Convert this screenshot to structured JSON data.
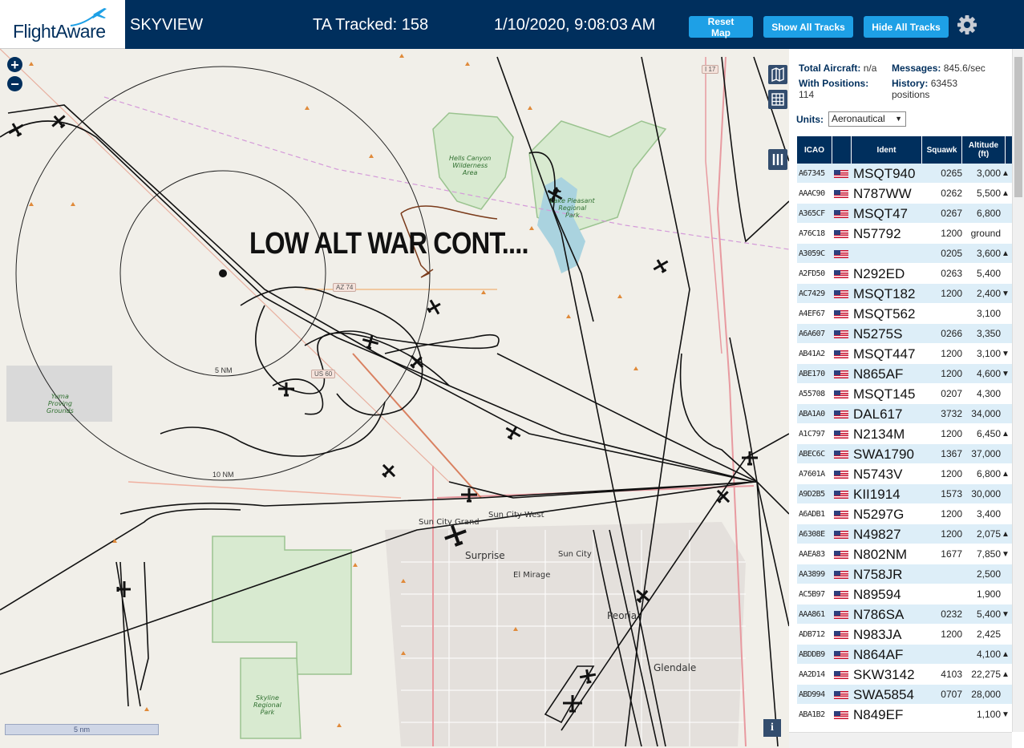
{
  "header": {
    "brand": "FlightAware",
    "app_name": "SKYVIEW",
    "tracked": "TA Tracked: 158",
    "datetime": "1/10/2020, 9:08:03 AM",
    "reset_label": "Reset Map",
    "show_label": "Show All Tracks",
    "hide_label": "Hide All Tracks",
    "accent_color": "#1ea0e6",
    "bar_color": "#002f5d"
  },
  "map": {
    "overlay_text": "LOW ALT WAR CONT....",
    "scale_label": "5 nm",
    "range_rings": [
      "5 NM",
      "10 NM"
    ],
    "places": {
      "hells_canyon": [
        "Hells Canyon",
        "Wilderness",
        "Area"
      ],
      "lake_pleasant": [
        "Lake Pleasant",
        "Regional",
        "Park"
      ],
      "yuma_proving": [
        "Yuma",
        "Proving",
        "Grounds"
      ],
      "skyline": [
        "Skyline",
        "Regional",
        "Park"
      ],
      "surprise": "Surprise",
      "sun_city": "Sun City",
      "sun_city_west": "Sun City West",
      "sun_city_grand": "Sun City Grand",
      "el_mirage": "El Mirage",
      "peoria": "Peoria",
      "glendale": "Glendale"
    },
    "road_labels": [
      "AZ 74",
      "US 60",
      "I 17"
    ]
  },
  "sidebar": {
    "total_label": "Total Aircraft:",
    "total_value": "n/a",
    "messages_label": "Messages:",
    "messages_value": "845.6/sec",
    "positions_label": "With Positions:",
    "positions_value": "114",
    "history_label": "History:",
    "history_value": "63453",
    "history_unit": "positions",
    "units_label": "Units:",
    "units_value": "Aeronautical",
    "columns": {
      "icao": "ICAO",
      "ident": "Ident",
      "squawk": "Squawk",
      "altitude": "Altitude (ft)"
    },
    "rows": [
      {
        "icao": "A67345",
        "ident": "MSQT940",
        "squawk": "0265",
        "alt": "3,000",
        "trend": "▲"
      },
      {
        "icao": "AAAC90",
        "ident": "N787WW",
        "squawk": "0262",
        "alt": "5,500",
        "trend": "▲"
      },
      {
        "icao": "A365CF",
        "ident": "MSQT47",
        "squawk": "0267",
        "alt": "6,800",
        "trend": ""
      },
      {
        "icao": "A76C18",
        "ident": "N57792",
        "squawk": "1200",
        "alt": "ground",
        "trend": ""
      },
      {
        "icao": "A3059C",
        "ident": "",
        "squawk": "0205",
        "alt": "3,600",
        "trend": "▲"
      },
      {
        "icao": "A2FD50",
        "ident": "N292ED",
        "squawk": "0263",
        "alt": "5,400",
        "trend": ""
      },
      {
        "icao": "AC7429",
        "ident": "MSQT182",
        "squawk": "1200",
        "alt": "2,400",
        "trend": "▼"
      },
      {
        "icao": "A4EF67",
        "ident": "MSQT562",
        "squawk": "",
        "alt": "3,100",
        "trend": ""
      },
      {
        "icao": "A6A607",
        "ident": "N5275S",
        "squawk": "0266",
        "alt": "3,350",
        "trend": ""
      },
      {
        "icao": "AB41A2",
        "ident": "MSQT447",
        "squawk": "1200",
        "alt": "3,100",
        "trend": "▼"
      },
      {
        "icao": "ABE170",
        "ident": "N865AF",
        "squawk": "1200",
        "alt": "4,600",
        "trend": "▼"
      },
      {
        "icao": "A55708",
        "ident": "MSQT145",
        "squawk": "0207",
        "alt": "4,300",
        "trend": ""
      },
      {
        "icao": "ABA1A0",
        "ident": "DAL617",
        "squawk": "3732",
        "alt": "34,000",
        "trend": ""
      },
      {
        "icao": "A1C797",
        "ident": "N2134M",
        "squawk": "1200",
        "alt": "6,450",
        "trend": "▲"
      },
      {
        "icao": "ABEC6C",
        "ident": "SWA1790",
        "squawk": "1367",
        "alt": "37,000",
        "trend": ""
      },
      {
        "icao": "A7601A",
        "ident": "N5743V",
        "squawk": "1200",
        "alt": "6,800",
        "trend": "▲"
      },
      {
        "icao": "A9D2B5",
        "ident": "KII1914",
        "squawk": "1573",
        "alt": "30,000",
        "trend": ""
      },
      {
        "icao": "A6ADB1",
        "ident": "N5297G",
        "squawk": "1200",
        "alt": "3,400",
        "trend": ""
      },
      {
        "icao": "A6308E",
        "ident": "N49827",
        "squawk": "1200",
        "alt": "2,075",
        "trend": "▲"
      },
      {
        "icao": "AAEA83",
        "ident": "N802NM",
        "squawk": "1677",
        "alt": "7,850",
        "trend": "▼"
      },
      {
        "icao": "AA3899",
        "ident": "N758JR",
        "squawk": "",
        "alt": "2,500",
        "trend": ""
      },
      {
        "icao": "AC5B97",
        "ident": "N89594",
        "squawk": "",
        "alt": "1,900",
        "trend": ""
      },
      {
        "icao": "AAA861",
        "ident": "N786SA",
        "squawk": "0232",
        "alt": "5,400",
        "trend": "▼"
      },
      {
        "icao": "ADB712",
        "ident": "N983JA",
        "squawk": "1200",
        "alt": "2,425",
        "trend": ""
      },
      {
        "icao": "ABDDB9",
        "ident": "N864AF",
        "squawk": "",
        "alt": "4,100",
        "trend": "▲"
      },
      {
        "icao": "AA2D14",
        "ident": "SKW3142",
        "squawk": "4103",
        "alt": "22,275",
        "trend": "▲"
      },
      {
        "icao": "ABD994",
        "ident": "SWA5854",
        "squawk": "0707",
        "alt": "28,000",
        "trend": ""
      },
      {
        "icao": "ABA1B2",
        "ident": "N849EF",
        "squawk": "",
        "alt": "1,100",
        "trend": "▼"
      }
    ]
  }
}
